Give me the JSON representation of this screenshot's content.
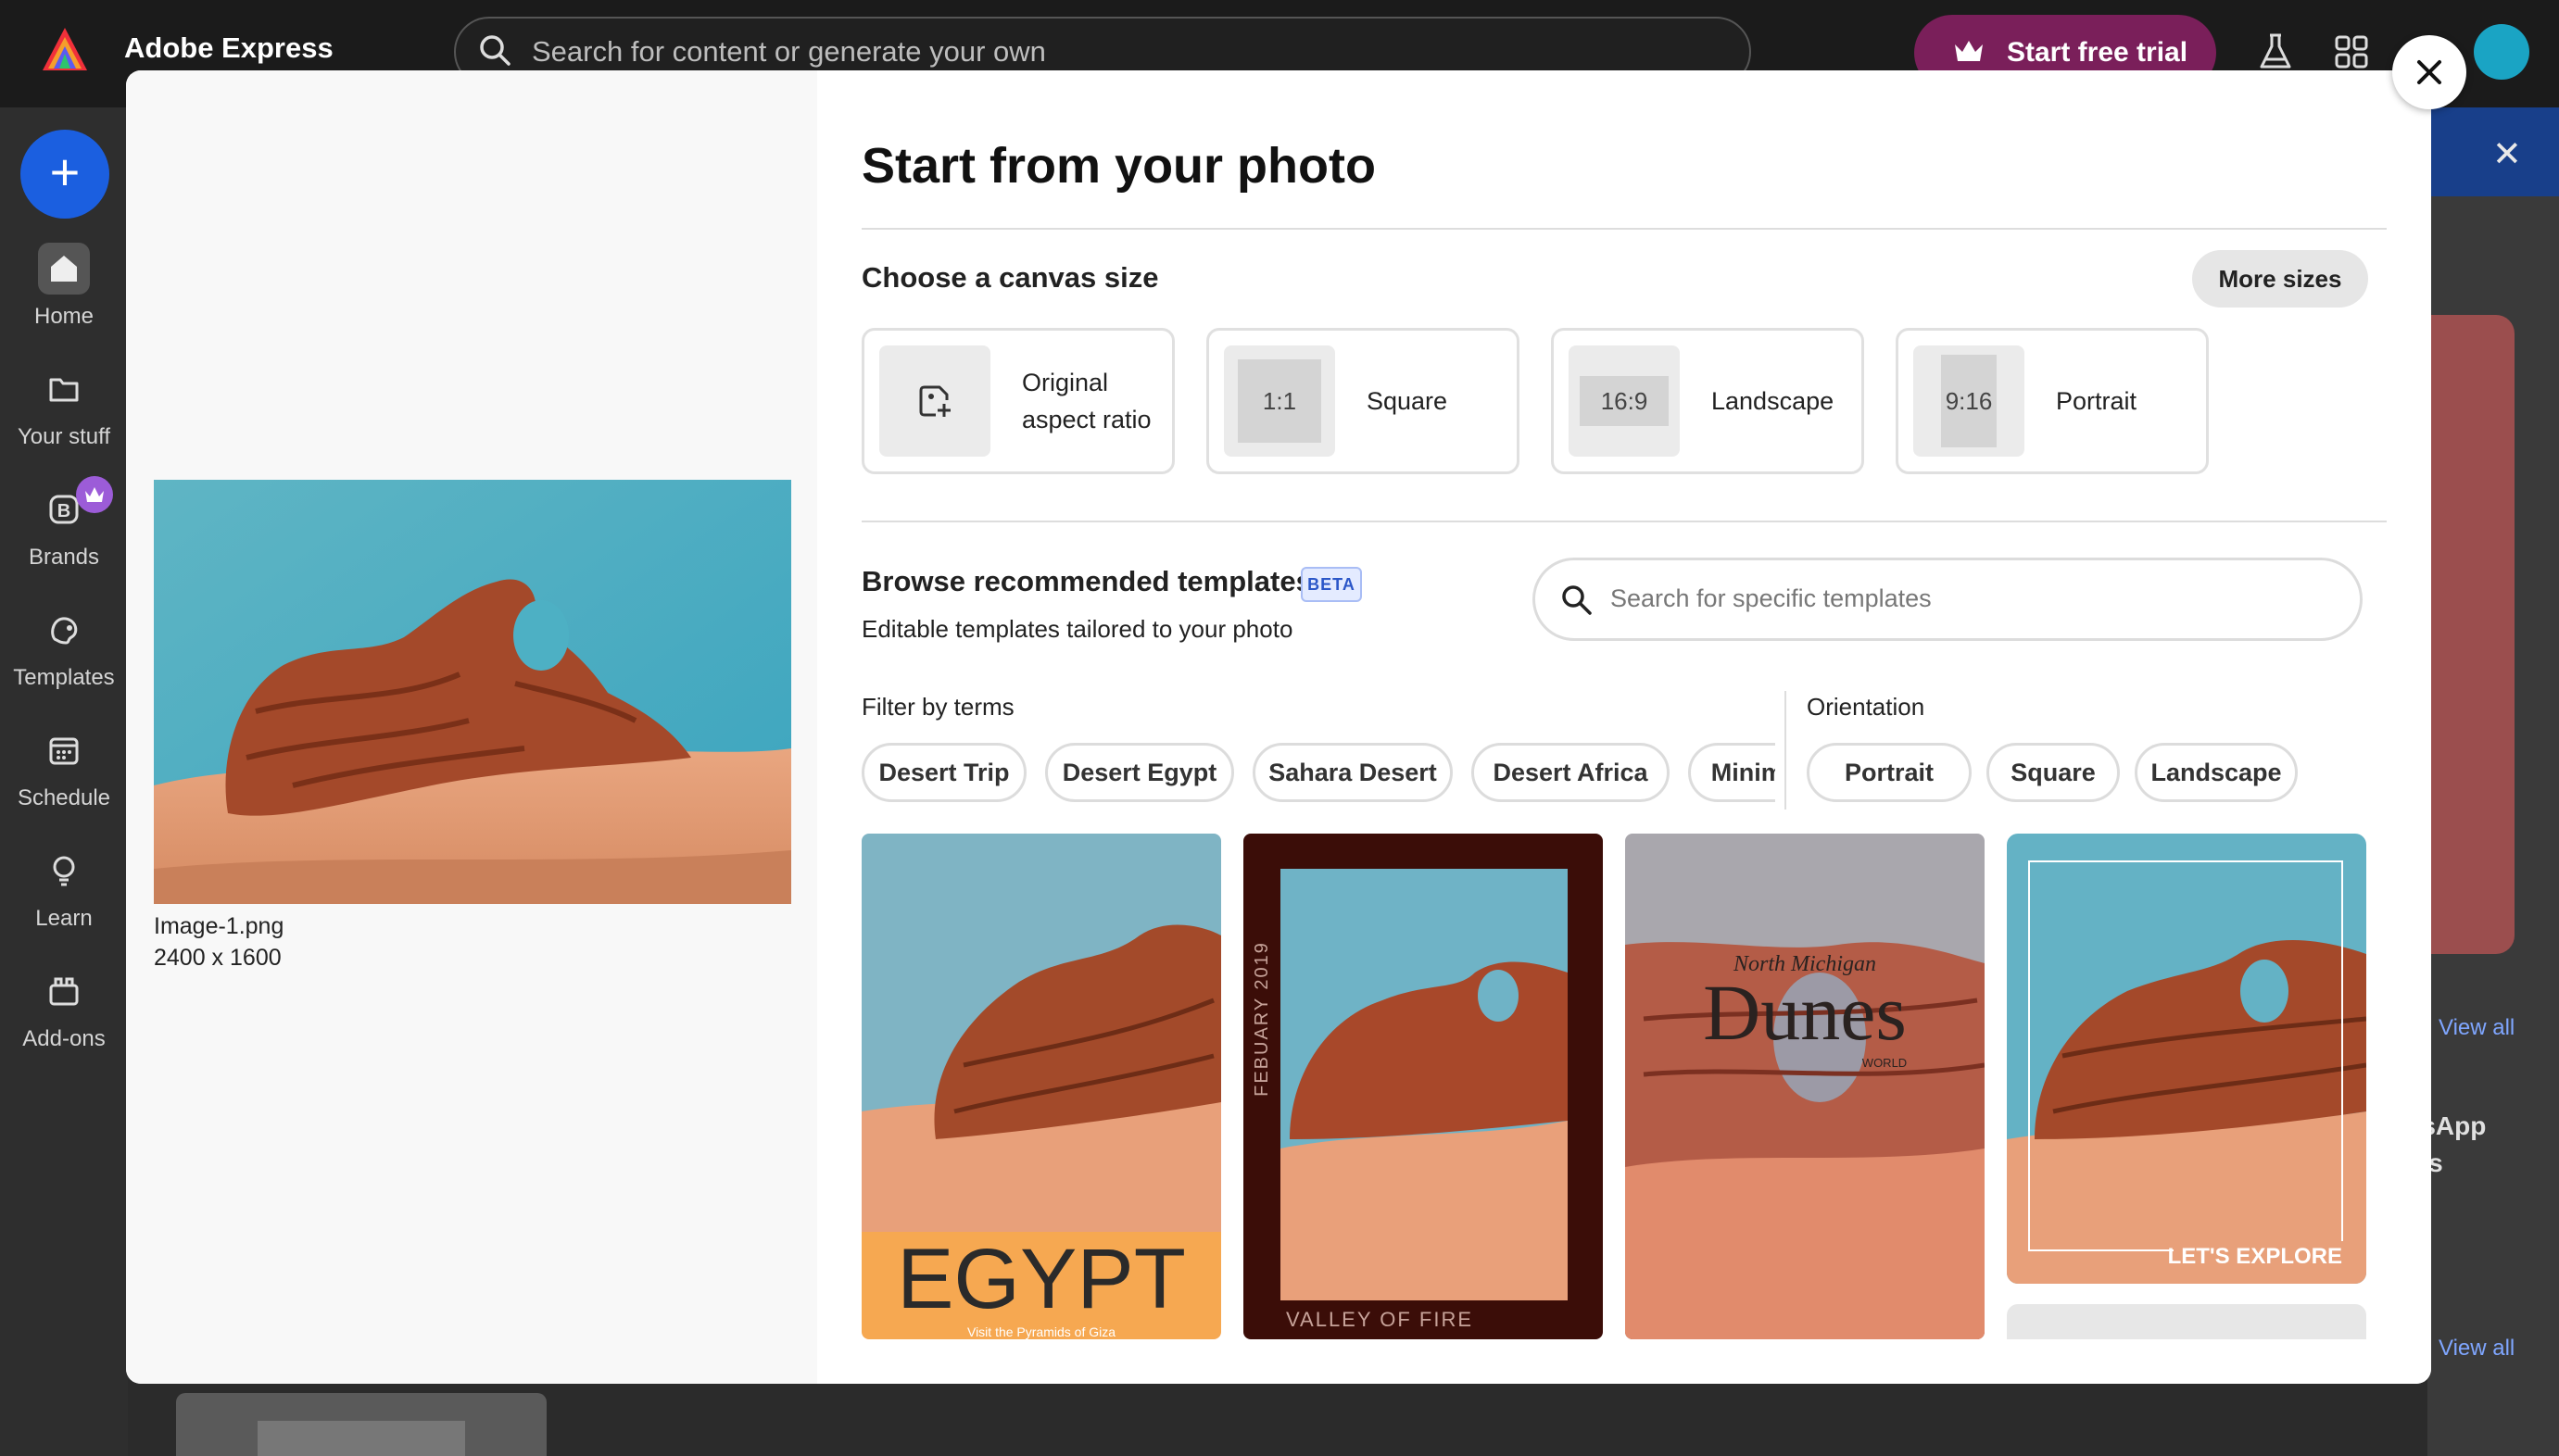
{
  "app": {
    "title": "Adobe Express",
    "search_placeholder": "Search for content or generate your own",
    "trial_label": "Start free trial"
  },
  "sidebar": {
    "create_label": "+",
    "items": [
      {
        "label": "Home",
        "icon": "home-icon"
      },
      {
        "label": "Your stuff",
        "icon": "folder-icon"
      },
      {
        "label": "Brands",
        "icon": "brand-icon"
      },
      {
        "label": "Templates",
        "icon": "templates-icon"
      },
      {
        "label": "Schedule",
        "icon": "calendar-icon"
      },
      {
        "label": "Learn",
        "icon": "lightbulb-icon"
      },
      {
        "label": "Add-ons",
        "icon": "addons-icon"
      }
    ]
  },
  "background": {
    "view_all_1": "View all",
    "view_all_2": "View all",
    "partial_text_1": "tsApp",
    "partial_text_2": "us",
    "close": "✕"
  },
  "modal": {
    "title": "Start from your photo",
    "photo": {
      "name": "Image-1.png",
      "dims": "2400 x 1600"
    },
    "canvas": {
      "heading": "Choose a canvas size",
      "more_sizes": "More sizes",
      "options": [
        {
          "label_line1": "Original",
          "label_line2": "aspect ratio",
          "ratio": ""
        },
        {
          "label_line1": "Square",
          "label_line2": "",
          "ratio": "1:1"
        },
        {
          "label_line1": "Landscape",
          "label_line2": "",
          "ratio": "16:9"
        },
        {
          "label_line1": "Portrait",
          "label_line2": "",
          "ratio": "9:16"
        }
      ]
    },
    "browse": {
      "heading": "Browse recommended templates",
      "badge": "BETA",
      "subtitle": "Editable templates tailored to your photo",
      "search_placeholder": "Search for specific templates"
    },
    "filters": {
      "terms_heading": "Filter by terms",
      "terms": [
        "Desert Trip",
        "Desert Egypt",
        "Sahara Desert",
        "Desert Africa",
        "Minimal"
      ],
      "orientation_heading": "Orientation",
      "orientations": [
        "Portrait",
        "Square",
        "Landscape"
      ]
    },
    "templates": [
      {
        "title": "EGYPT",
        "subtitle": "Visit the Pyramids of Giza"
      },
      {
        "vertical": "FEBUARY 2019",
        "caption": "VALLEY OF FIRE"
      },
      {
        "script": "North Michigan",
        "title": "Dunes",
        "subtitle": "WORLD"
      },
      {
        "caption": "LET'S EXPLORE"
      }
    ]
  }
}
